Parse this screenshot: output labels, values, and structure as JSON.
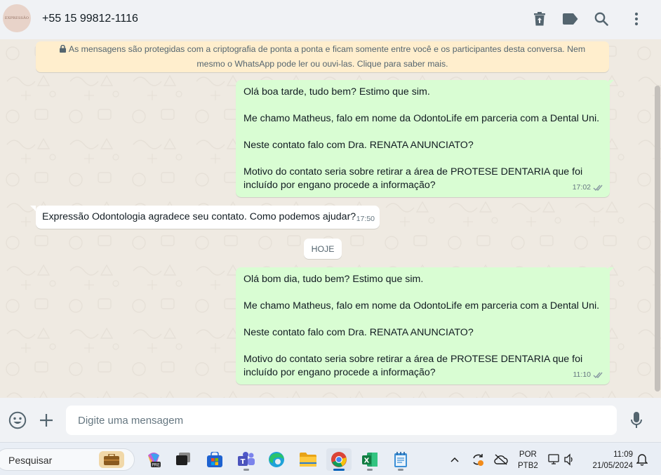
{
  "header": {
    "avatar_text": "EXPRESSÃO",
    "contact_name": "+55 15 99812-1116"
  },
  "encryption_notice": {
    "line1": "As mensagens são protegidas com a criptografia de ponta a ponta e ficam somente entre você e os participantes desta conversa. Nem",
    "line2": "mesmo o WhatsApp pode ler ou ouvi-las. Clique para saber mais."
  },
  "messages": [
    {
      "direction": "out",
      "lines": [
        "Olá boa tarde, tudo bem? Estimo que sim.",
        "",
        "Me chamo Matheus, falo em nome da OdontoLife em parceria com a Dental Uni.",
        "",
        "Neste contato falo com Dra. RENATA ANUNCIATO?",
        "",
        "Motivo do contato seria sobre retirar a área de PROTESE DENTARIA que foi",
        "incluído por engano procede a informação?"
      ],
      "time": "17:02",
      "status": "delivered"
    },
    {
      "direction": "in",
      "lines": [
        "Expressão Odontologia agradece seu contato. Como podemos ajudar?"
      ],
      "time": "17:50"
    },
    {
      "direction": "out",
      "lines": [
        "Olá bom dia, tudo bem? Estimo que sim.",
        "",
        "Me chamo Matheus, falo em nome da OdontoLife em parceria com a Dental Uni.",
        "",
        "Neste contato falo com Dra. RENATA ANUNCIATO?",
        "",
        "Motivo do contato seria sobre retirar a área de PROTESE DENTARIA que foi",
        "incluído por engano procede a informação?"
      ],
      "time": "11:10",
      "status": "delivered"
    }
  ],
  "day_divider": "HOJE",
  "composer": {
    "placeholder": "Digite uma mensagem"
  },
  "taskbar": {
    "search_label": "Pesquisar",
    "language_line1": "POR",
    "language_line2": "PTB2",
    "time": "11:09",
    "date": "21/05/2024"
  },
  "colors": {
    "outgoing_bubble": "#d9fdd3",
    "incoming_bubble": "#ffffff",
    "encryption_banner": "#ffeecd",
    "header_bg": "#f0f2f5",
    "chat_bg": "#efeae2",
    "read_ticks": "#8696a0"
  }
}
